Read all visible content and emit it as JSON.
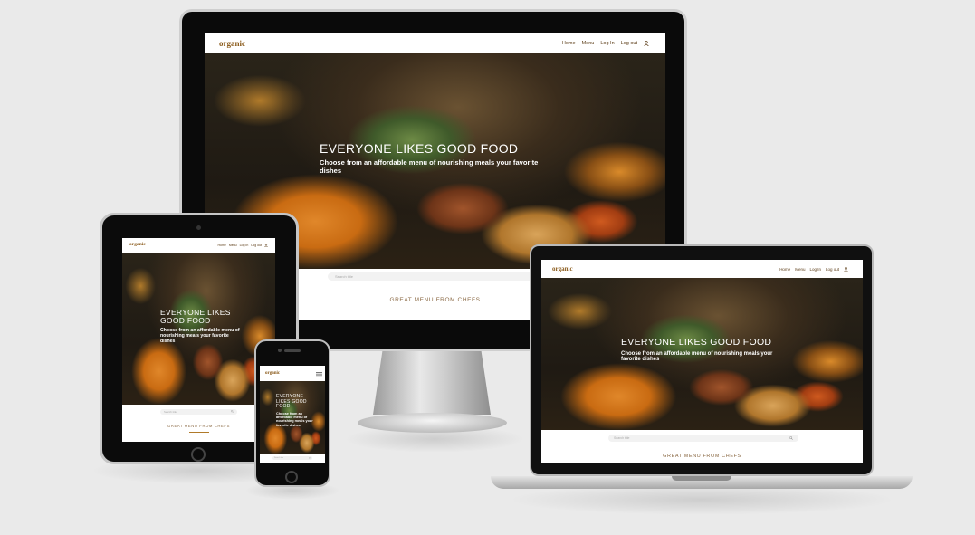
{
  "site": {
    "logo": "organic",
    "logo_tag": "",
    "nav": {
      "home": "Home",
      "menu": "Menu",
      "login": "Log In",
      "logout": "Log out",
      "user_icon": "user-icon",
      "hamburger_icon": "hamburger-menu-icon"
    },
    "hero": {
      "title": "EVERYONE LIKES GOOD FOOD",
      "subtitle": "Choose from an affordable menu of nourishing meals your favorite dishes"
    },
    "search": {
      "placeholder": "Search title",
      "icon": "search-icon"
    },
    "section_title": "GREAT MENU FROM CHEFS"
  },
  "colors": {
    "background": "#eaeaea",
    "accent": "#b07a2a",
    "nav_text": "#5a3a14"
  }
}
